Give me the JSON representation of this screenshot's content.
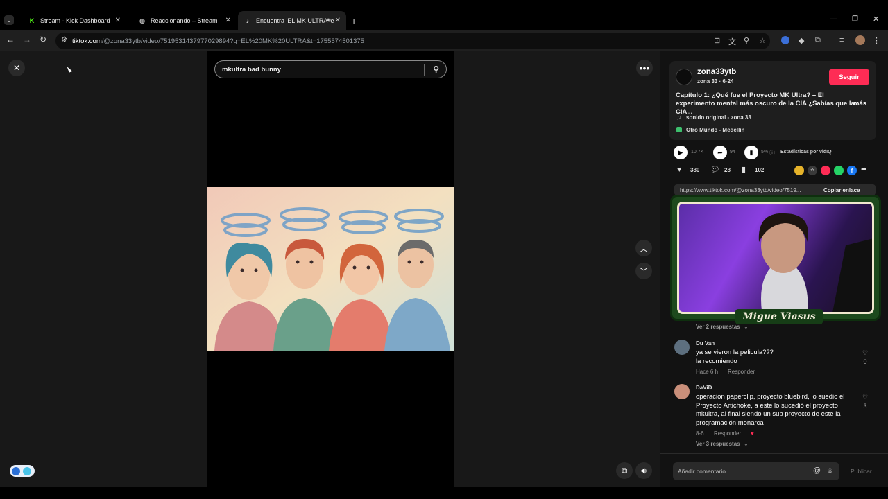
{
  "browser": {
    "tabs": [
      {
        "title": "Stream - Kick Dashboard",
        "favicon": "kick-icon",
        "active": false
      },
      {
        "title": "Reaccionando – Stream",
        "favicon": "globe-icon",
        "active": false
      },
      {
        "title": "Encuentra 'EL MK ULTRA' e",
        "favicon": "tiktok-icon",
        "active": true
      }
    ],
    "url_host": "tiktok.com",
    "url_path": "/@zona33ytb/video/7519531437977029894?q=EL%20MK%20ULTRA&t=1755574501375"
  },
  "search": {
    "value": "mkultra bad bunny"
  },
  "author": {
    "username": "zona33ytb",
    "subtitle": "zona 33 · 6-24",
    "follow_label": "Seguir",
    "caption": "Capítulo 1: ¿Qué fue el Proyecto MK Ultra? – El experimento mental más oscuro de la CIA ¿Sabías que la CIA...",
    "more_label": "más",
    "sound": "sonido original - zona 33",
    "location": "Otro Mundo - Medellín"
  },
  "stats": {
    "views": "10.7K",
    "shares": "94",
    "percent": "5%",
    "vidiq_label": "Estadísticas por vidIQ",
    "likes": "380",
    "comments": "28",
    "saves": "102"
  },
  "link": {
    "text": "https://www.tiktok.com/@zona33ytb/video/7519...",
    "copy_label": "Copiar enlace"
  },
  "cam_overlay_name": "Migue Viasus",
  "comments": [
    {
      "replies": "Ver 2 respuestas"
    },
    {
      "name": "Du Van",
      "text": "ya se vieron la pelicula???\nla recomiendo",
      "time": "Hace 6 h",
      "reply": "Responder",
      "likes": "0"
    },
    {
      "name": "DaViD",
      "text": "operacion paperclip, proyecto bluebird, lo suedio el Proyecto Artichoke, a este lo sucedió el proyecto mkultra, al final siendo un sub proyecto de este la programación monarca",
      "time": "8-6",
      "reply": "Responder",
      "likes": "3",
      "replies": "Ver 3 respuestas"
    }
  ],
  "comment_box": {
    "placeholder": "Añadir comentario...",
    "publish_label": "Publicar"
  },
  "colors": {
    "accent": "#fe2c55",
    "cam_frame": "#1d4a1d"
  }
}
